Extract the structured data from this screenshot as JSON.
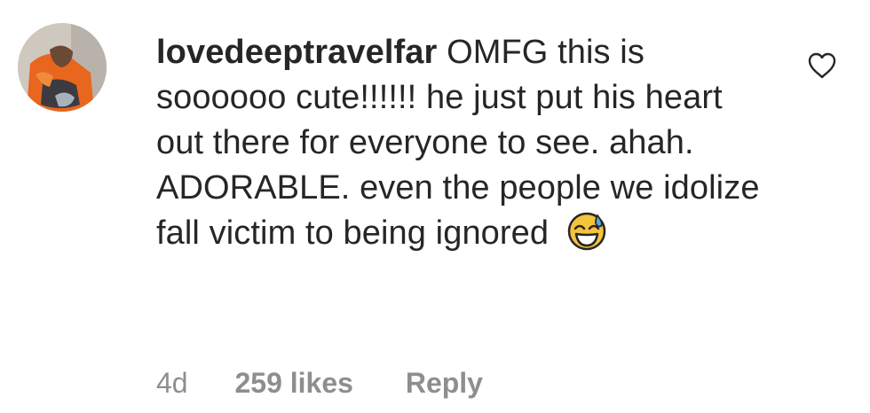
{
  "comment": {
    "username": "lovedeeptravelfar",
    "text": "OMFG this is soooooo cute!!!!!! he just put his heart out there for everyone to see. ahah. ADORABLE. even the people we idolize fall victim to being ignored",
    "emoji": "grinning-face-with-sweat-icon",
    "timestamp": "4d",
    "likes": "259 likes",
    "reply_label": "Reply",
    "like_icon": "heart-outline-icon"
  },
  "colors": {
    "text": "#262626",
    "meta": "#8e8e8e",
    "background": "#ffffff"
  }
}
